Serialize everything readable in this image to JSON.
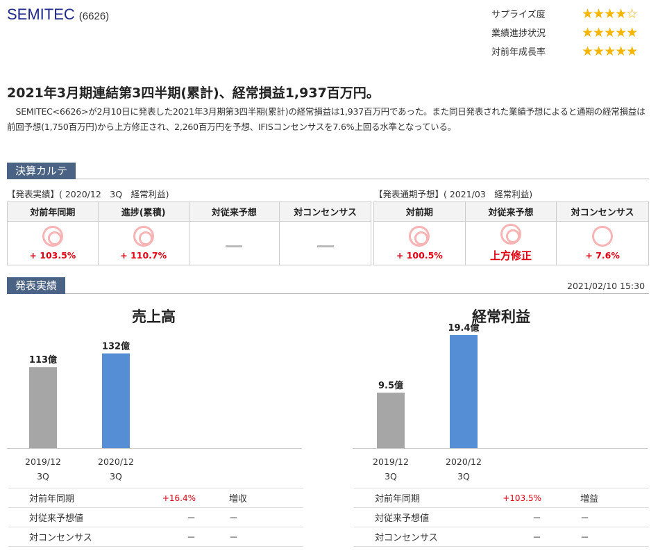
{
  "company": {
    "name": "SEMITEC",
    "code": "(6626)"
  },
  "ratings": [
    {
      "label": "サプライズ度",
      "stars": "★★★★☆"
    },
    {
      "label": "業績進捗状況",
      "stars": "★★★★★"
    },
    {
      "label": "対前年成長率",
      "stars": "★★★★★"
    }
  ],
  "headline": "2021年3月期連結第3四半期(累計)、経常損益1,937百万円。",
  "body": "SEMITEC<6626>が2月10日に発表した2021年3月期第3四半期(累計)の経常損益は1,937百万円であった。また同日発表された業績予想によると通期の経常損益は前回予想(1,750百万円)から上方修正され、2,260百万円を予想、IFISコンセンサスを7.6%上回る水準となっている。",
  "karte": {
    "title": "決算カルテ",
    "results": {
      "label": "【発表実績】( 2020/12　3Q　経常利益)",
      "headers": [
        "対前年同期",
        "進捗(累積)",
        "対従来予想",
        "対コンセンサス"
      ],
      "values": [
        "+ 103.5%",
        "+ 110.7%",
        "",
        ""
      ],
      "marks": [
        "double",
        "double",
        "dash",
        "dash"
      ]
    },
    "forecast": {
      "label": "【発表通期予想】( 2021/03　経常利益)",
      "headers": [
        "対前期",
        "対従来予想",
        "対コンセンサス"
      ],
      "values": [
        "+ 100.5%",
        "上方修正",
        "+ 7.6%"
      ],
      "marks": [
        "double",
        "double",
        "single"
      ]
    }
  },
  "results_section": {
    "title": "発表実績",
    "timestamp": "2021/02/10 15:30"
  },
  "chart_data": [
    {
      "type": "bar",
      "title": "売上高",
      "categories": [
        "2019/12 3Q",
        "2020/12 3Q"
      ],
      "category_lines": [
        [
          "2019/12",
          "3Q"
        ],
        [
          "2020/12",
          "3Q"
        ]
      ],
      "values": [
        113,
        132
      ],
      "labels": [
        "113億",
        "132億"
      ],
      "unit": "億",
      "colors": [
        "#a6a6a6",
        "#558ed5"
      ],
      "ylim": [
        0,
        150
      ]
    },
    {
      "type": "bar",
      "title": "経常利益",
      "categories": [
        "2019/12 3Q",
        "2020/12 3Q"
      ],
      "category_lines": [
        [
          "2019/12",
          "3Q"
        ],
        [
          "2020/12",
          "3Q"
        ]
      ],
      "values": [
        9.5,
        19.4
      ],
      "labels": [
        "9.5億",
        "19.4億"
      ],
      "unit": "億",
      "colors": [
        "#a6a6a6",
        "#558ed5"
      ],
      "ylim": [
        0,
        20
      ]
    }
  ],
  "metrics": [
    {
      "rows": [
        {
          "label": "対前年同期",
          "value": "+16.4%",
          "note": "増収"
        },
        {
          "label": "対従来予想値",
          "value": "－",
          "note": "－"
        },
        {
          "label": "対コンセンサス",
          "value": "－",
          "note": "－"
        }
      ]
    },
    {
      "rows": [
        {
          "label": "対前年同期",
          "value": "+103.5%",
          "note": "増益"
        },
        {
          "label": "対従来予想値",
          "value": "－",
          "note": "－"
        },
        {
          "label": "対コンセンサス",
          "value": "－",
          "note": "－"
        }
      ]
    }
  ],
  "colors": {
    "accent": "#1e2a8c",
    "section_bg": "#4a6283",
    "positive": "#e00012",
    "star": "#f6b600",
    "mark": "#f8b4b4"
  }
}
